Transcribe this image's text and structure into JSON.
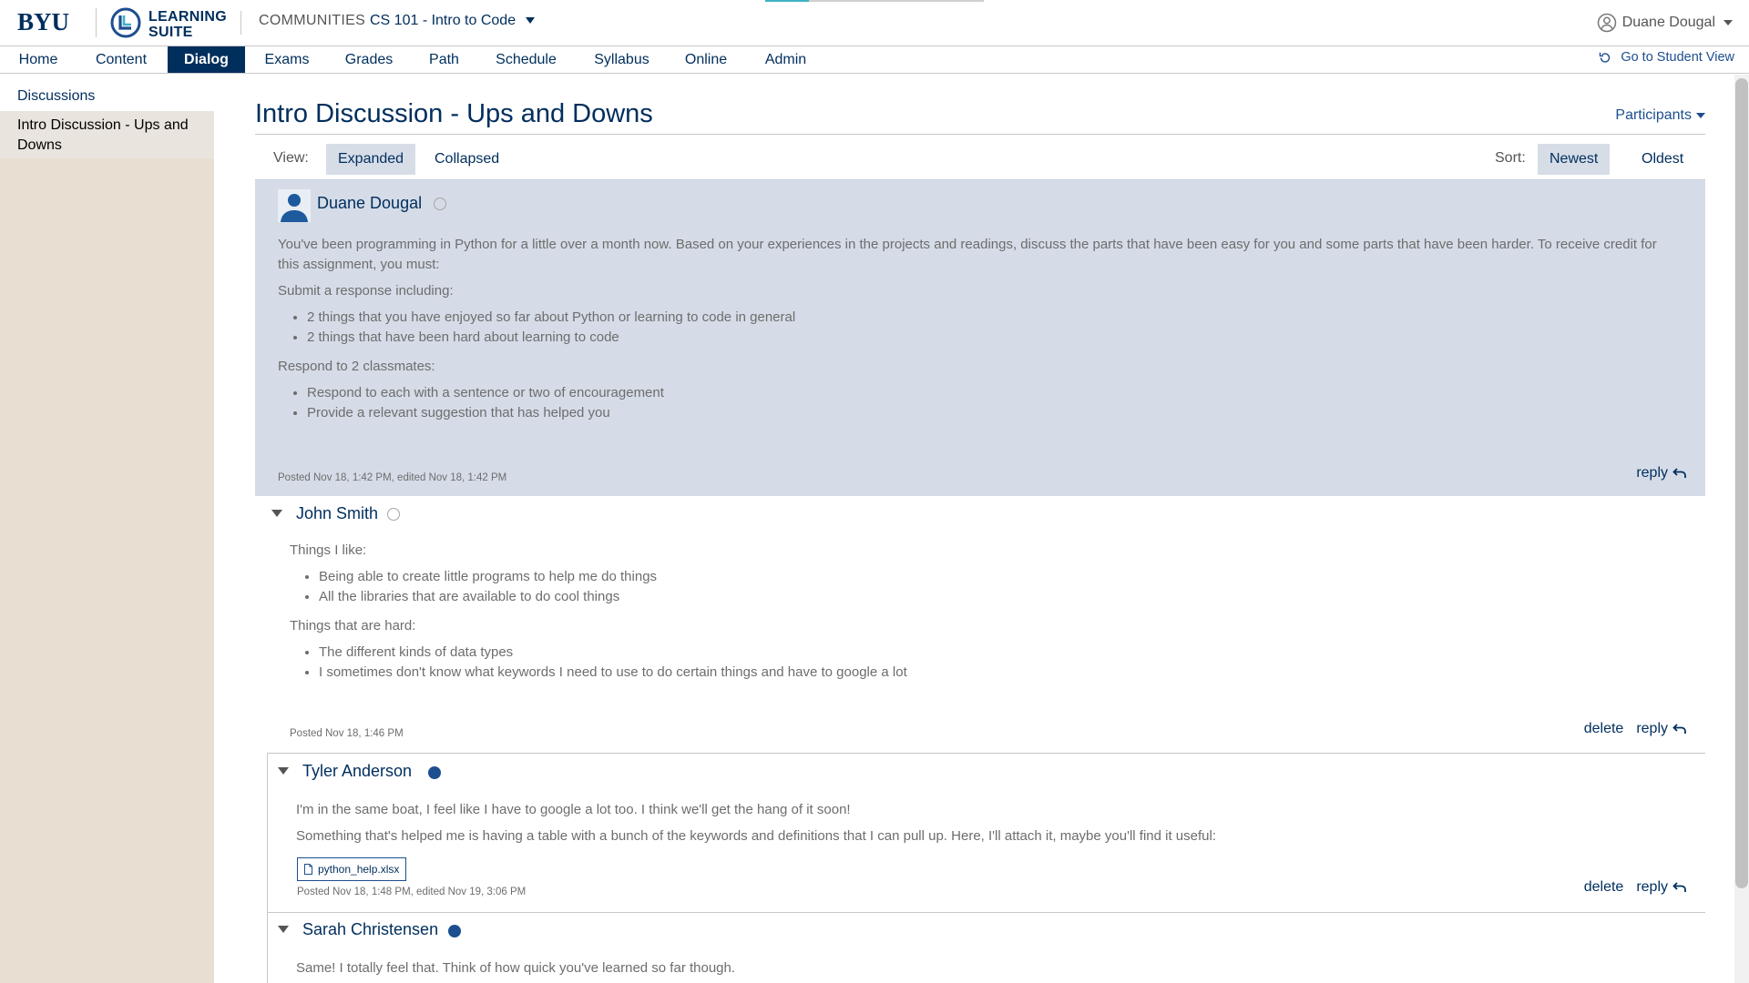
{
  "header": {
    "brand": "BYU",
    "learning_suite_line1": "LEARNING",
    "learning_suite_line2": "SUITE",
    "section_label": "COMMUNITIES",
    "course": "CS 101 - Intro to Code",
    "user": "Duane Dougal"
  },
  "nav": {
    "items": [
      "Home",
      "Content",
      "Dialog",
      "Exams",
      "Grades",
      "Path",
      "Schedule",
      "Syllabus",
      "Online",
      "Admin"
    ],
    "active": "Dialog",
    "student_view": "Go to Student View"
  },
  "sidebar": {
    "heading": "Discussions",
    "items": [
      "Intro Discussion - Ups and Downs"
    ]
  },
  "discussion": {
    "title": "Intro Discussion - Ups and Downs",
    "participants_label": "Participants",
    "view_label": "View:",
    "view_options": [
      "Expanded",
      "Collapsed"
    ],
    "view_selected": "Expanded",
    "sort_label": "Sort:",
    "sort_options": [
      "Newest",
      "Oldest"
    ],
    "sort_selected": "Newest"
  },
  "posts": {
    "op": {
      "author": "Duane Dougal",
      "intro": "You've been programming in Python for a little over a month now. Based on your experiences in the projects and readings, discuss the parts that have been easy for you and some parts that have been harder. To receive credit for this assignment, you must:",
      "section1": "Submit a response including:",
      "list1": [
        "2 things that you have enjoyed so far about Python or learning to code in general",
        "2 things that have been hard about learning to code"
      ],
      "section2": "Respond to 2 classmates:",
      "list2": [
        "Respond to each with a sentence or two of encouragement",
        "Provide a relevant suggestion that has helped you"
      ],
      "meta": "Posted Nov 18, 1:42 PM, edited Nov 18, 1:42 PM",
      "reply": "reply"
    },
    "john": {
      "author": "John Smith",
      "section1": "Things I like:",
      "list1": [
        "Being able to create little programs to help me do things",
        "All the libraries that are available to do cool things"
      ],
      "section2": "Things that are hard:",
      "list2": [
        "The different kinds of data types",
        "I sometimes don't know what keywords I need to use to do certain things and have to google a lot"
      ],
      "meta": "Posted Nov 18, 1:46 PM",
      "delete": "delete",
      "reply": "reply"
    },
    "tyler": {
      "author": "Tyler Anderson",
      "line1": "I'm in the same boat, I feel like I have to google a lot too. I think we'll get the hang of it soon!",
      "line2": "Something that's helped me is having a table with a bunch of the keywords and definitions that I can pull up. Here, I'll attach it, maybe you'll find it useful:",
      "attachment": "python_help.xlsx",
      "meta": "Posted Nov 18, 1:48 PM, edited Nov 19, 3:06 PM",
      "delete": "delete",
      "reply": "reply"
    },
    "sarah": {
      "author": "Sarah Christensen",
      "line1": "Same! I totally feel that. Think of how quick you've learned so far though."
    }
  },
  "colors": {
    "brand_navy": "#002e5d",
    "link_blue": "#1d4e8f",
    "op_background": "#d5dce7",
    "sidebar_background": "#e8dfd2",
    "accent_teal": "#3fb1c6"
  },
  "icons": [
    "user-circle-icon",
    "chevron-down-icon",
    "undo-icon",
    "person-avatar-icon",
    "reply-arrow-icon",
    "triangle-collapse-icon",
    "file-icon"
  ]
}
